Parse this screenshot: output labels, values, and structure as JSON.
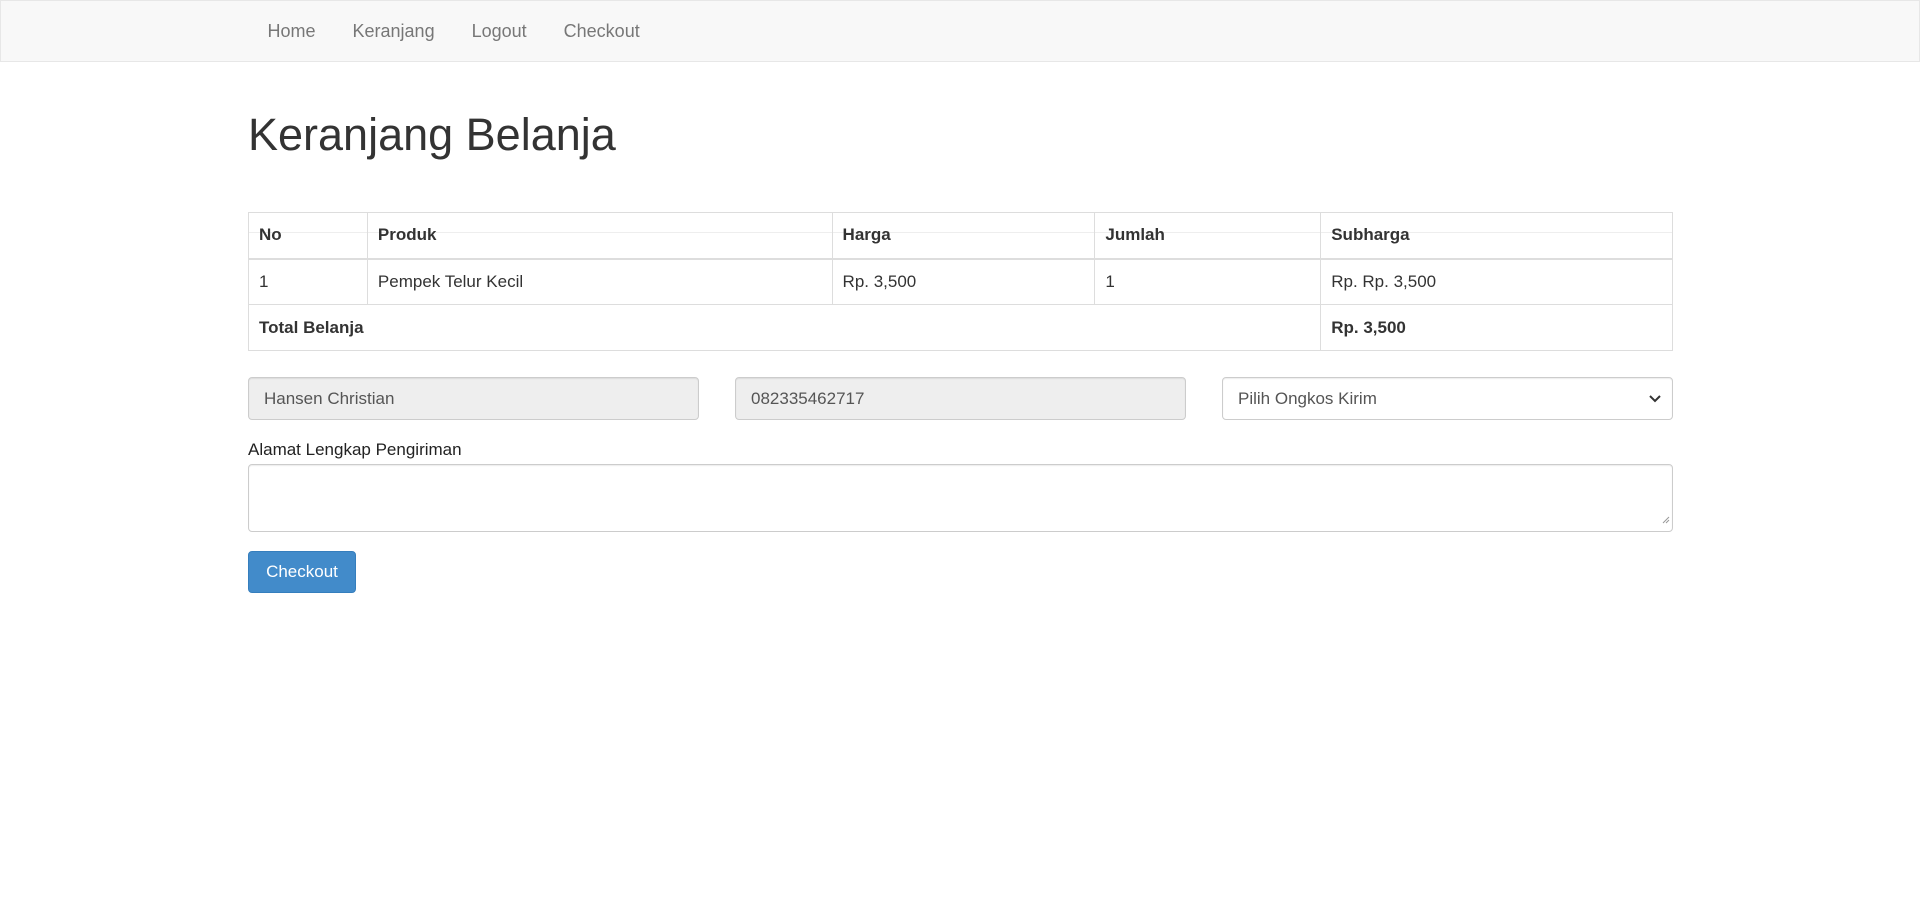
{
  "nav": {
    "items": [
      {
        "label": "Home"
      },
      {
        "label": "Keranjang"
      },
      {
        "label": "Logout"
      },
      {
        "label": "Checkout"
      }
    ]
  },
  "page": {
    "title": "Keranjang Belanja"
  },
  "table": {
    "headers": [
      "No",
      "Produk",
      "Harga",
      "Jumlah",
      "Subharga"
    ],
    "rows": [
      {
        "no": "1",
        "produk": "Pempek Telur Kecil",
        "harga": "Rp. 3,500",
        "jumlah": "1",
        "subharga": "Rp. Rp. 3,500"
      }
    ],
    "total_label": "Total Belanja",
    "total_value": "Rp. 3,500"
  },
  "form": {
    "name_value": "Hansen Christian",
    "phone_value": "082335462717",
    "shipping_select": "Pilih Ongkos Kirim",
    "address_label": "Alamat Lengkap Pengiriman",
    "address_value": "",
    "submit_label": "Checkout"
  },
  "colors": {
    "primary": "#428bca",
    "navbar_bg": "#f8f8f8",
    "readonly_bg": "#eeeeee"
  }
}
